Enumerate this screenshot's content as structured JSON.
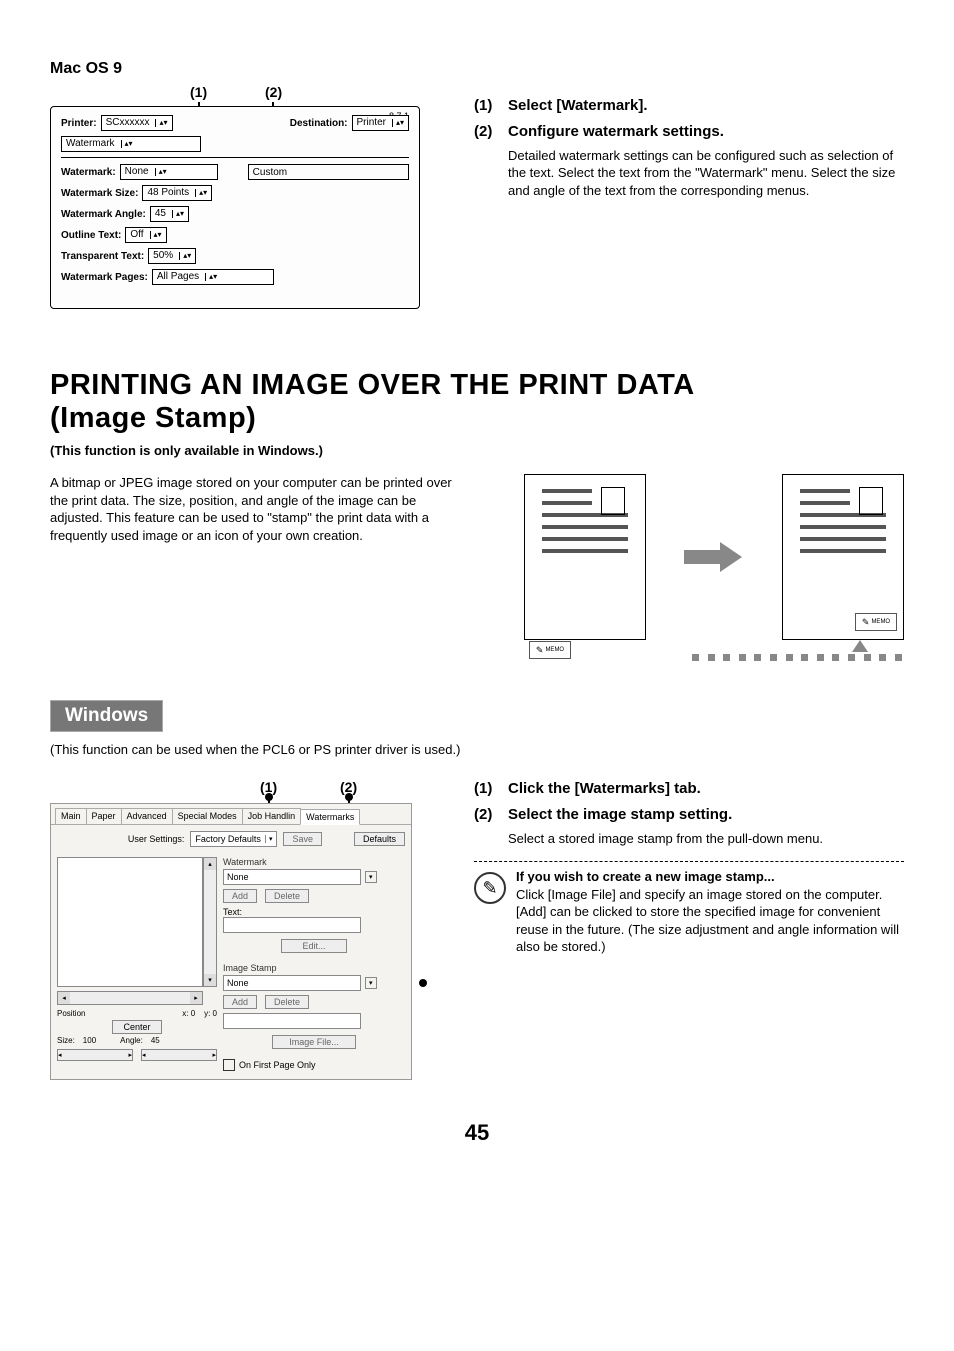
{
  "macos": {
    "heading": "Mac OS 9",
    "callout1": "(1)",
    "callout2": "(2)",
    "version": "8.7.1",
    "labels": {
      "printer": "Printer:",
      "destination": "Destination:",
      "watermark": "Watermark:",
      "watermark_size": "Watermark Size:",
      "watermark_angle": "Watermark Angle:",
      "outline_text": "Outline Text:",
      "transparent_text": "Transparent Text:",
      "watermark_pages": "Watermark Pages:"
    },
    "values": {
      "printer": "SCxxxxxx",
      "destination": "Printer",
      "menu": "Watermark",
      "watermark": "None",
      "custom": "Custom",
      "watermark_size": "48 Points",
      "watermark_angle": "45",
      "outline_text": "Off",
      "transparent_text": "50%",
      "watermark_pages": "All Pages"
    },
    "steps": {
      "one": {
        "num": "(1)",
        "title": "Select [Watermark]."
      },
      "two": {
        "num": "(2)",
        "title": "Configure watermark settings.",
        "body": "Detailed watermark settings can be configured such as selection of the text. Select the text from the \"Watermark\" menu. Select the size and angle of the text from the corresponding menus."
      }
    }
  },
  "main_heading": {
    "line1": "PRINTING AN IMAGE OVER THE PRINT DATA",
    "line2": "(Image Stamp)"
  },
  "availability": "(This function is only available in Windows.)",
  "intro_para": "A bitmap or JPEG image stored on your computer can be printed over the print data. The size, position, and angle of the image can be adjusted. This feature can be used to \"stamp\" the print data with a frequently used image or an icon of your own creation.",
  "memo_label": "MEMO",
  "windows": {
    "tag": "Windows",
    "driver_note": "(This function can be used when the PCL6 or PS printer driver is used.)",
    "callout1": "(1)",
    "callout2": "(2)",
    "tabs": [
      "Main",
      "Paper",
      "Advanced",
      "Special Modes",
      "Job Handlin",
      "Watermarks"
    ],
    "user_settings_label": "User Settings:",
    "user_settings_value": "Factory Defaults",
    "save": "Save",
    "defaults": "Defaults",
    "watermark_group": {
      "label": "Watermark",
      "value": "None",
      "add": "Add",
      "delete": "Delete",
      "text_label": "Text:",
      "edit": "Edit..."
    },
    "image_stamp_group": {
      "label": "Image Stamp",
      "value": "None",
      "add": "Add",
      "delete": "Delete",
      "image_file": "Image File..."
    },
    "first_page": "On First Page Only",
    "preview": {
      "position": "Position",
      "x": "x:",
      "y": "y:",
      "xval": "0",
      "yval": "0",
      "center": "Center",
      "size": "Size:",
      "size_val": "100",
      "angle": "Angle:",
      "angle_val": "45"
    },
    "steps": {
      "one": {
        "num": "(1)",
        "title": "Click the [Watermarks] tab."
      },
      "two": {
        "num": "(2)",
        "title": "Select the image stamp setting.",
        "body": "Select a stored image stamp from the pull-down menu."
      }
    },
    "note": {
      "title": "If you wish to create a new image stamp...",
      "body": "Click [Image File] and specify an image stored on the computer. [Add] can be clicked to store the specified image for convenient reuse in the future. (The size adjustment and angle information will also be stored.)"
    }
  },
  "page_number": "45"
}
